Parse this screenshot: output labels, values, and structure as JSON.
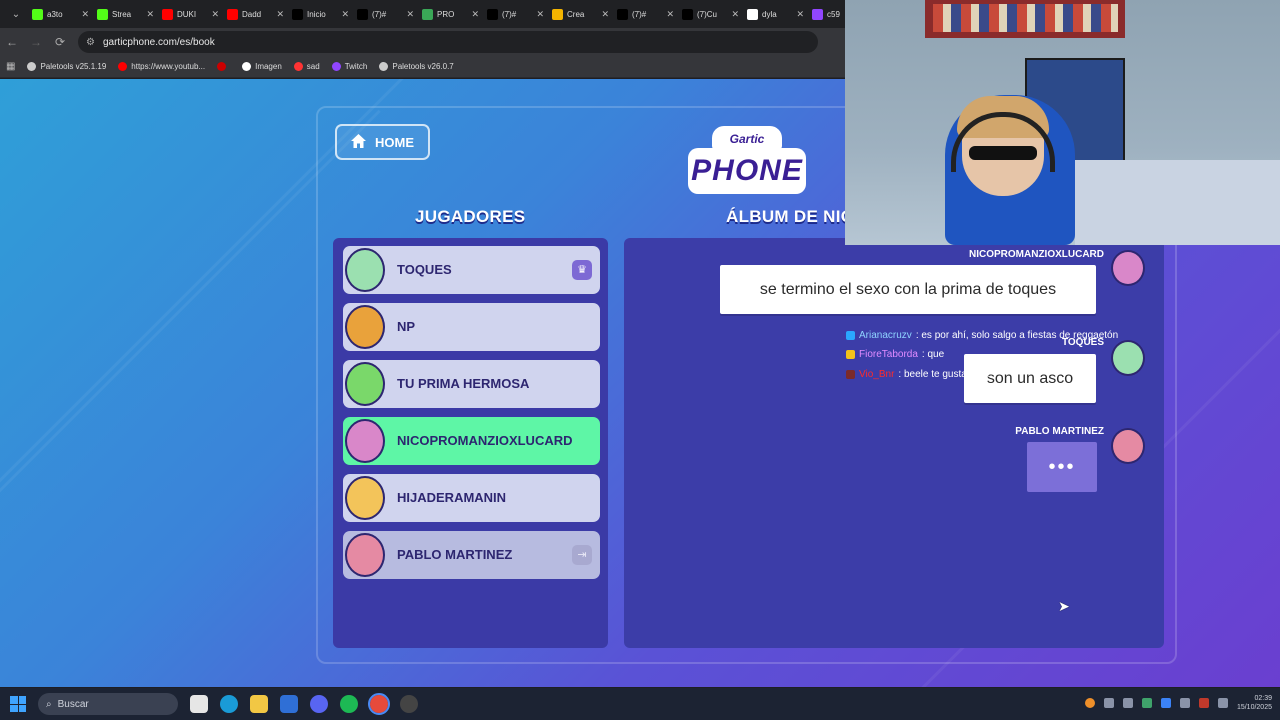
{
  "browser": {
    "tabs": [
      {
        "title": "a3to",
        "icon": "kick-icon",
        "color": "#53fc18"
      },
      {
        "title": "Strea",
        "icon": "kick-icon",
        "color": "#53fc18"
      },
      {
        "title": "DUKI",
        "icon": "youtube-icon",
        "color": "#ff0000"
      },
      {
        "title": "Dadd",
        "icon": "youtube-icon",
        "color": "#ff0000"
      },
      {
        "title": "Inicio",
        "icon": "x-icon",
        "color": "#000000"
      },
      {
        "title": "(7)#",
        "icon": "tiktok-icon",
        "color": "#000000"
      },
      {
        "title": "PRO",
        "icon": "game-icon",
        "color": "#3aa757"
      },
      {
        "title": "(7)#",
        "icon": "tiktok-icon",
        "color": "#000000"
      },
      {
        "title": "Crea",
        "icon": "doc-icon",
        "color": "#f4b400"
      },
      {
        "title": "(7)#",
        "icon": "tiktok-icon",
        "color": "#000000"
      },
      {
        "title": "(7)Cu",
        "icon": "tiktok-icon",
        "color": "#000000"
      },
      {
        "title": "dyla",
        "icon": "google-icon",
        "color": "#ffffff"
      },
      {
        "title": "c59",
        "icon": "twitch-icon",
        "color": "#9146ff"
      }
    ],
    "url": "garticphone.com/es/book",
    "bookmarks": [
      {
        "label": "Paletools v25.1.19",
        "color": "#cccccc"
      },
      {
        "label": "https://www.youtub...",
        "color": "#ff0000"
      },
      {
        "label": "",
        "color": "#cc0000"
      },
      {
        "label": "Imagen",
        "color": "#ffffff"
      },
      {
        "label": "sad",
        "color": "#ff3333"
      },
      {
        "label": "Twitch",
        "color": "#9146ff"
      },
      {
        "label": "Paletools v26.0.7",
        "color": "#cccccc"
      }
    ]
  },
  "game": {
    "home_label": "HOME",
    "logo_top": "Gartic",
    "logo_bottom": "PHONE",
    "players_heading": "JUGADORES",
    "album_heading": "ÁLBUM DE NIC",
    "players": [
      {
        "name": "TOQUES",
        "state": "host",
        "badge": "crown-icon",
        "avatar_color": "#9be0b0"
      },
      {
        "name": "NP",
        "state": "normal",
        "badge": "",
        "avatar_color": "#e9a23b"
      },
      {
        "name": "TU PRIMA HERMOSA",
        "state": "normal",
        "badge": "",
        "avatar_color": "#7ad86a"
      },
      {
        "name": "NICOPROMANZIOXLUCARD",
        "state": "active",
        "badge": "",
        "avatar_color": "#d987c9"
      },
      {
        "name": "HIJADERAMANIN",
        "state": "normal",
        "badge": "",
        "avatar_color": "#f3c45a"
      },
      {
        "name": "PABLO MARTINEZ",
        "state": "dim",
        "badge": "exit-icon",
        "avatar_color": "#e58aa3"
      }
    ],
    "album": [
      {
        "author": "NICOPROMANZIOXLUCARD",
        "text": "se termino el sexo con la prima de toques",
        "avatar_color": "#d987c9"
      },
      {
        "author": "TOQUES",
        "text": "son un asco",
        "avatar_color": "#9be0b0"
      },
      {
        "author": "PABLO MARTINEZ",
        "text": "•••",
        "avatar_color": "#e58aa3"
      }
    ]
  },
  "chat": [
    {
      "user": "Arianacruzv",
      "user_color": "#8fd3ff",
      "message": ": es por ahí, solo salgo a fiestas de reggaetón",
      "icon_color": "#2aa8ff"
    },
    {
      "user": "FioreTaborda",
      "user_color": "#e08bff",
      "message": ": que",
      "icon_color": "#f2c21b"
    },
    {
      "user": "Vio_Bnr",
      "user_color": "#ff2a2a",
      "message": ": beele te gusta Fiore?",
      "icon_color": "#7b2a2a"
    }
  ],
  "taskbar": {
    "search_placeholder": "Buscar",
    "time": "02:39",
    "date": "15/10/2025"
  }
}
